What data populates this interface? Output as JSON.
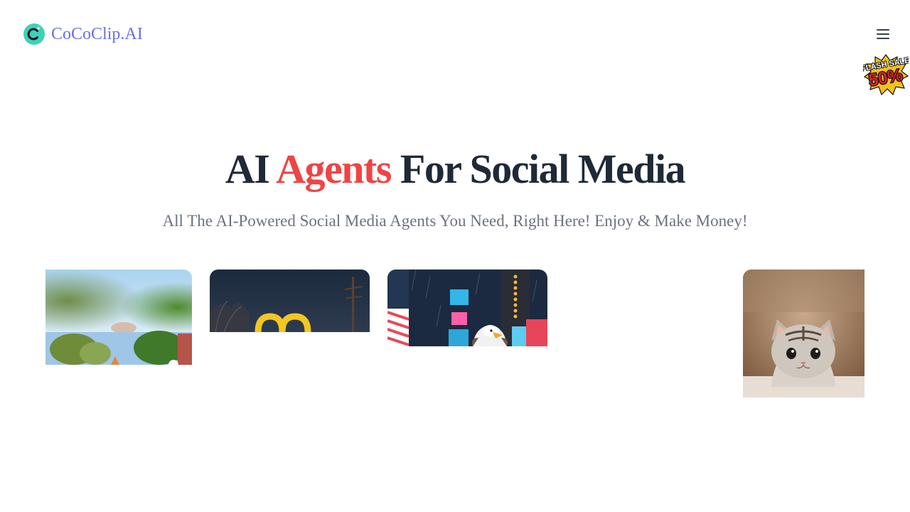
{
  "header": {
    "brand_name": "CoCoClip.AI",
    "logo_icon": "cococlip-logo-icon",
    "menu_icon": "hamburger-menu-icon",
    "flash_sale_badge": {
      "text_top": "FLASH SALE",
      "text_main": "50%",
      "icon": "flash-sale-badge-icon"
    }
  },
  "hero": {
    "title_prefix": "AI ",
    "title_accent": "Agents",
    "title_suffix": " For Social Media",
    "subtitle": "All The AI-Powered Social Media Agents You Need, Right Here! Enjoy & Make Money!"
  },
  "gallery": {
    "cards": [
      {
        "subject": "outdoor-street-thumbnail"
      },
      {
        "subject": "golden-arches-night-thumbnail"
      },
      {
        "subject": "eagle-city-rain-thumbnail"
      },
      {
        "subject": "kitten-thumbnail"
      }
    ]
  },
  "colors": {
    "brand": "#6b6fe6",
    "accent": "#ef4444",
    "heading": "#1f2937",
    "subtitle": "#6b7280",
    "logo_teal": "#3fd1b8"
  }
}
